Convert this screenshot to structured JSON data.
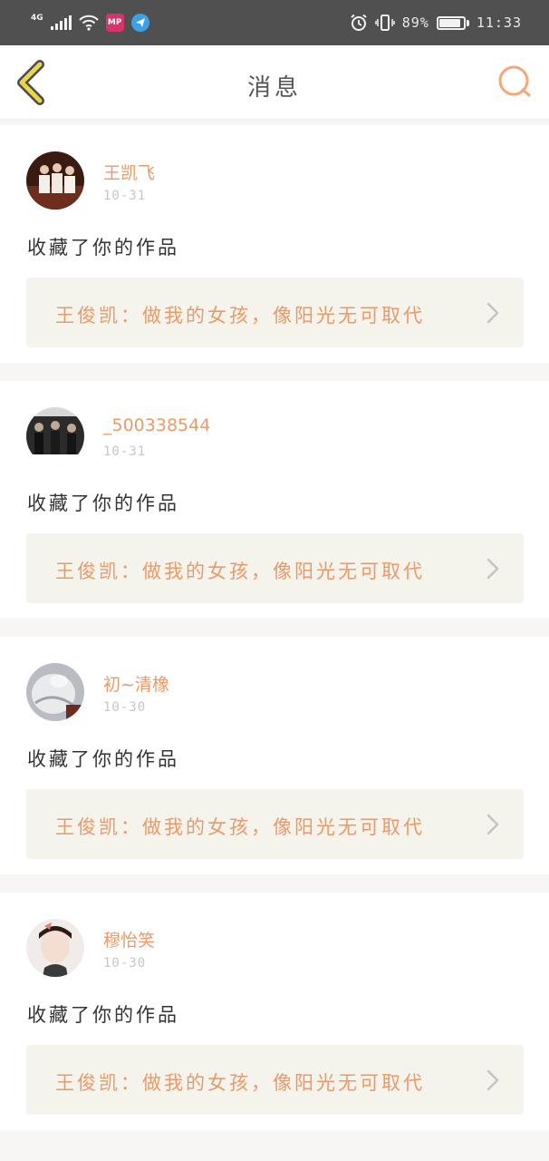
{
  "status_bar": {
    "network": "4G",
    "mp_app": "MP",
    "battery": "89%",
    "time": "11:33"
  },
  "header": {
    "title": "消息"
  },
  "notifications": [
    {
      "username": "王凯飞",
      "date": "10-31",
      "action": "收藏了你的作品",
      "work_title": "王俊凯：做我的女孩，像阳光无可取代"
    },
    {
      "username": "_500338544",
      "date": "10-31",
      "action": "收藏了你的作品",
      "work_title": "王俊凯：做我的女孩，像阳光无可取代"
    },
    {
      "username": "初~清橡",
      "date": "10-30",
      "action": "收藏了你的作品",
      "work_title": "王俊凯：做我的女孩，像阳光无可取代"
    },
    {
      "username": "穆怡笑",
      "date": "10-30",
      "action": "收藏了你的作品",
      "work_title": "王俊凯：做我的女孩，像阳光无可取代"
    }
  ],
  "colors": {
    "accent": "#ea9a68",
    "status_bar": "#505050",
    "card_link_bg": "#f4f3ec",
    "back_icon": "#e8d64a"
  }
}
